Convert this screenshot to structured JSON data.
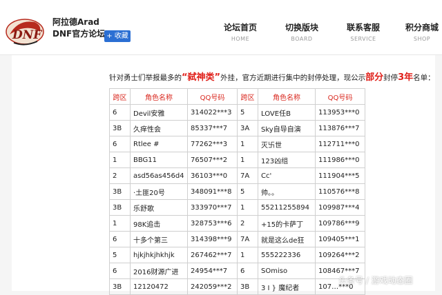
{
  "site": {
    "name": "阿拉德Arad",
    "subtitle": "DNF官方论坛",
    "favorite_label": "+ 收藏"
  },
  "nav": [
    {
      "cn": "论坛首页",
      "en": "HOME"
    },
    {
      "cn": "切换版块",
      "en": "BOARD"
    },
    {
      "cn": "联系客服",
      "en": "SERVICE"
    },
    {
      "cn": "积分商城",
      "en": "SHOP"
    }
  ],
  "notice": {
    "part1": "针对勇士们举报最多的",
    "quote": "“弑神类”",
    "part2": "外挂，官方近期进行集中的封停处理，现公示",
    "part_hl": "部分",
    "part3": "封停",
    "years_hl": "3年",
    "part4": "名单："
  },
  "table": {
    "headers": [
      "跨区",
      "角色名称",
      "QQ号码",
      "跨区",
      "角色名称",
      "QQ号码"
    ],
    "rows": [
      [
        "6",
        "Devil安雅",
        "314022***3",
        "5",
        "LOVE任B",
        "113953***0"
      ],
      [
        "3B",
        "久痒性会",
        "85337***7",
        "3A",
        "Sky自导自演",
        "113876***7"
      ],
      [
        "6",
        "Rtlee #",
        "77262***3",
        "1",
        "灭卐世",
        "112711***0"
      ],
      [
        "1",
        "BBG11",
        "76507***2",
        "1",
        "123凶组",
        "111986***0"
      ],
      [
        "2",
        "asd56as456d4",
        "36103***0",
        "7A",
        "Cc'",
        "111904***5"
      ],
      [
        "3B",
        "·土匪20号",
        "348091***8",
        "5",
        "帅。。",
        "110576***8"
      ],
      [
        "3B",
        "乐舒歌",
        "333970***7",
        "1",
        "55211255894",
        "109987***4"
      ],
      [
        "1",
        "98K追击",
        "328753***6",
        "2",
        "+15的卡萨丁",
        "109786***9"
      ],
      [
        "6",
        "十多个第三",
        "314398***9",
        "7A",
        "就是这么de狂",
        "109405***1"
      ],
      [
        "5",
        "hjkjhkjhkhjk",
        "267462***7",
        "1",
        "555222336",
        "109264***2"
      ],
      [
        "6",
        "2016财源广进",
        "24954***7",
        "6",
        "SOmiso",
        "108467***7"
      ],
      [
        "3B",
        "12120472",
        "242059***2",
        "3B",
        "3 I } 魔纪者",
        "107…***0"
      ]
    ]
  },
  "watermark": "头条号 / 游戏动态圈",
  "colors": {
    "accent_red": "#e0201a",
    "header_red": "#d9281f",
    "favorite_blue": "#2b6fd3"
  }
}
